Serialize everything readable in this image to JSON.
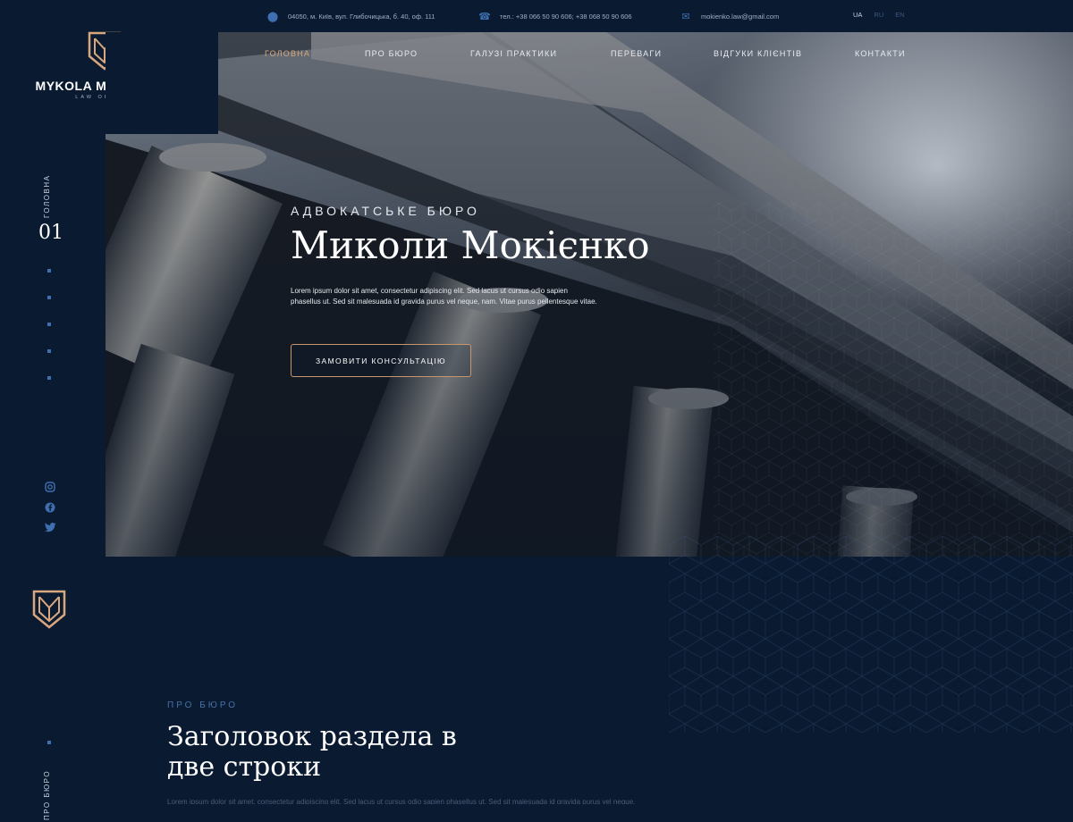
{
  "contacts": {
    "address": "04050, м. Київ, вул. Глибочицька, б. 40, оф. 111",
    "phone": "тел.: +38 066 50 90 606; +38 068 50 90 606",
    "email": "mokienko.law@gmail.com"
  },
  "languages": [
    {
      "label": "UA"
    },
    {
      "label": "RU"
    },
    {
      "label": "EN"
    }
  ],
  "brand": {
    "name": "MYKOLA MOKIIENKO",
    "sub": "LAW OFFICE"
  },
  "nav": [
    {
      "label": "ГОЛОВНА"
    },
    {
      "label": "ПРО БЮРО"
    },
    {
      "label": "ГАЛУЗІ ПРАКТИКИ"
    },
    {
      "label": "ПЕРЕВАГИ"
    },
    {
      "label": "ВІДГУКИ КЛІЄНТІВ"
    },
    {
      "label": "КОНТАКТИ"
    }
  ],
  "side": {
    "section_label": "ГОЛОВНА",
    "section_number": "01",
    "section2_label": "ПРО БЮРО"
  },
  "hero": {
    "eyebrow": "АДВОКАТСЬКЕ БЮРО",
    "title": "Миколи Мокієнко",
    "text": "Lorem ipsum dolor sit amet, consectetur adipiscing elit. Sed lacus ut cursus odio sapien phasellus ut. Sed sit malesuada id gravida purus vel neque, nam. Vitae purus pellentesque vitae.",
    "cta": "ЗАМОВИТИ КОНСУЛЬТАЦІЮ"
  },
  "about": {
    "eyebrow": "ПРО БЮРО",
    "title_line1": "Заголовок раздела в",
    "title_line2": "две строки",
    "text": "Lorem ipsum dolor sit amet, consectetur adipiscing elit. Sed lacus ut cursus odio sapien phasellus ut. Sed sit malesuada id gravida purus vel neque."
  },
  "colors": {
    "background": "#0a1a30",
    "accent": "#d8a77e",
    "blue": "#3f6fb0"
  }
}
